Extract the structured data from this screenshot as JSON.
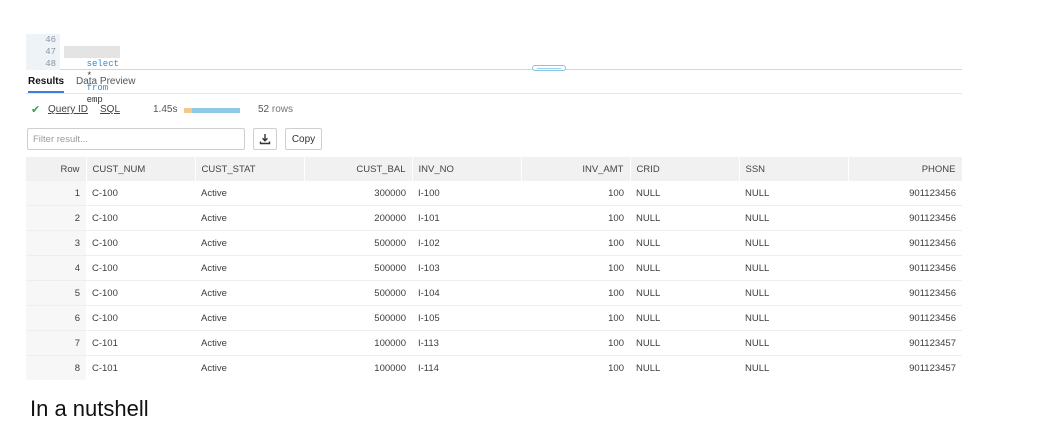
{
  "editor": {
    "lines": [
      {
        "num": "46",
        "text": ""
      },
      {
        "num": "47",
        "text": "select * from emp"
      },
      {
        "num": "48",
        "text": ""
      }
    ],
    "keywords": {
      "select": "select",
      "star": "*",
      "from": "from",
      "table": "emp"
    }
  },
  "tabs": [
    {
      "label": "Results",
      "active": true
    },
    {
      "label": "Data Preview",
      "active": false
    }
  ],
  "status": {
    "success": true,
    "query_id_label": "Query ID",
    "sql_label": "SQL",
    "duration": "1.45s",
    "row_count": "52",
    "rows_label": "rows"
  },
  "filter": {
    "placeholder": "Filter result...",
    "value": ""
  },
  "actions": {
    "download_icon": "download-icon",
    "copy_label": "Copy"
  },
  "grid": {
    "columns": [
      "Row",
      "CUST_NUM",
      "CUST_STAT",
      "CUST_BAL",
      "INV_NO",
      "INV_AMT",
      "CRID",
      "SSN",
      "PHONE"
    ],
    "rows": [
      [
        "1",
        "C-100",
        "Active",
        "300000",
        "I-100",
        "100",
        "NULL",
        "NULL",
        "901123456"
      ],
      [
        "2",
        "C-100",
        "Active",
        "200000",
        "I-101",
        "100",
        "NULL",
        "NULL",
        "901123456"
      ],
      [
        "3",
        "C-100",
        "Active",
        "500000",
        "I-102",
        "100",
        "NULL",
        "NULL",
        "901123456"
      ],
      [
        "4",
        "C-100",
        "Active",
        "500000",
        "I-103",
        "100",
        "NULL",
        "NULL",
        "901123456"
      ],
      [
        "5",
        "C-100",
        "Active",
        "500000",
        "I-104",
        "100",
        "NULL",
        "NULL",
        "901123456"
      ],
      [
        "6",
        "C-100",
        "Active",
        "500000",
        "I-105",
        "100",
        "NULL",
        "NULL",
        "901123456"
      ],
      [
        "7",
        "C-101",
        "Active",
        "100000",
        "I-113",
        "100",
        "NULL",
        "NULL",
        "901123457"
      ],
      [
        "8",
        "C-101",
        "Active",
        "100000",
        "I-114",
        "100",
        "NULL",
        "NULL",
        "901123457"
      ]
    ]
  },
  "footer_text": "In a nutshell",
  "colors": {
    "accent": "#3b7fd9",
    "success": "#3aa34a",
    "keyword": "#2f8dd0",
    "header_bg": "#f1f1f1"
  }
}
